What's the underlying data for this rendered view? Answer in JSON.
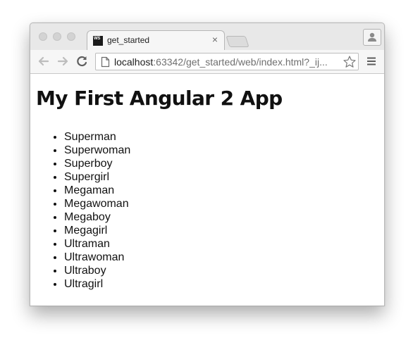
{
  "browser": {
    "tab": {
      "favicon_text": "WS",
      "title": "get_started",
      "close_glyph": "×"
    },
    "address": {
      "host": "localhost",
      "rest": ":63342/get_started/web/index.html?_ij..."
    },
    "icons": {
      "back": "arrow-left-icon",
      "forward": "arrow-right-icon",
      "reload": "reload-icon",
      "page": "page-icon",
      "bookmark": "star-icon",
      "menu": "hamburger-menu-icon",
      "profile": "person-icon"
    }
  },
  "page": {
    "heading": "My First Angular 2 App",
    "heroes": [
      "Superman",
      "Superwoman",
      "Superboy",
      "Supergirl",
      "Megaman",
      "Megawoman",
      "Megaboy",
      "Megagirl",
      "Ultraman",
      "Ultrawoman",
      "Ultraboy",
      "Ultragirl"
    ]
  }
}
